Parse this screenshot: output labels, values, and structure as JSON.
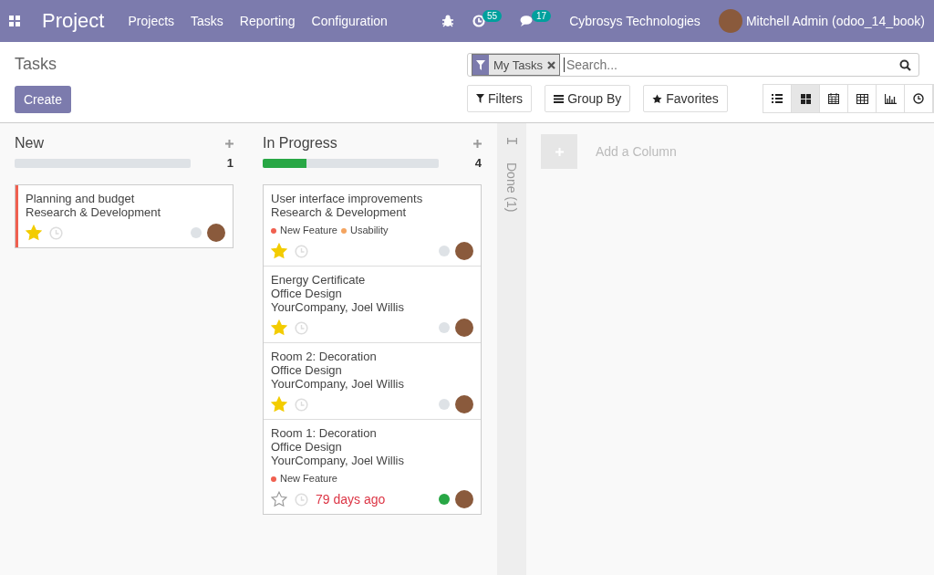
{
  "navbar": {
    "app_title": "Project",
    "menu": [
      "Projects",
      "Tasks",
      "Reporting",
      "Configuration"
    ],
    "activity_count": "55",
    "message_count": "17",
    "company": "Cybrosys Technologies",
    "user": "Mitchell Admin (odoo_14_book)"
  },
  "control_panel": {
    "title": "Tasks",
    "create_label": "Create",
    "facet": "My Tasks",
    "search_placeholder": "Search...",
    "filters": "Filters",
    "group_by": "Group By",
    "favorites": "Favorites",
    "views": [
      {
        "kind": "list",
        "selected": false
      },
      {
        "kind": "kanban",
        "selected": true
      },
      {
        "kind": "calendar",
        "selected": false
      },
      {
        "kind": "pivot",
        "selected": false
      },
      {
        "kind": "graph",
        "selected": false
      },
      {
        "kind": "activity",
        "selected": false
      }
    ]
  },
  "columns": [
    {
      "name": "New",
      "count": "1",
      "level": 0,
      "cards": [
        {
          "title": "Planning and budget",
          "project": "Research & Development",
          "color": "#f06050",
          "starred": true,
          "done": false
        }
      ]
    },
    {
      "name": "In Progress",
      "count": "4",
      "level": 0.25,
      "cards": [
        {
          "title": "User interface improvements",
          "project": "Research & Development",
          "tags": [
            {
              "name": "New Feature",
              "color": "#f06050"
            },
            {
              "name": "Usability",
              "color": "#f4a460"
            }
          ],
          "starred": true,
          "done": false
        },
        {
          "title": "Energy Certificate",
          "project": "Office Design",
          "customer": "YourCompany, Joel Willis",
          "starred": true,
          "done": false
        },
        {
          "title": "Room 2: Decoration",
          "project": "Office Design",
          "customer": "YourCompany, Joel Willis",
          "starred": true,
          "done": false
        },
        {
          "title": "Room 1: Decoration",
          "project": "Office Design",
          "customer": "YourCompany, Joel Willis",
          "tags": [
            {
              "name": "New Feature",
              "color": "#f06050"
            }
          ],
          "starred": false,
          "deadline": "79 days ago",
          "done": true
        }
      ]
    }
  ],
  "folded_column": {
    "label": "Done (1)"
  },
  "add_column": "Add a Column"
}
